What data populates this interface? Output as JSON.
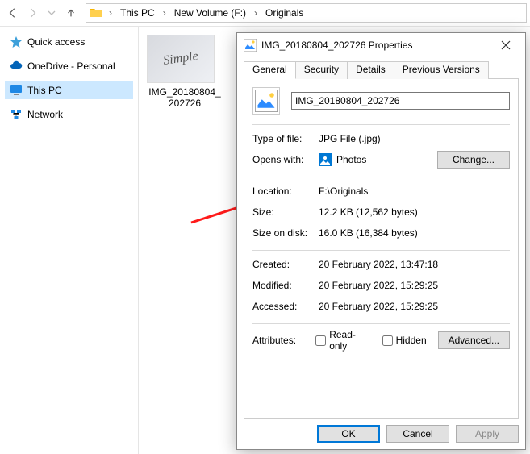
{
  "nav": {
    "breadcrumbs": [
      "This PC",
      "New Volume (F:)",
      "Originals"
    ]
  },
  "tree": {
    "quick_access": "Quick access",
    "onedrive": "OneDrive - Personal",
    "this_pc": "This PC",
    "network": "Network"
  },
  "file": {
    "thumb_name": "IMG_20180804_202726"
  },
  "dialog": {
    "title": "IMG_20180804_202726 Properties",
    "tabs": {
      "general": "General",
      "security": "Security",
      "details": "Details",
      "prev": "Previous Versions"
    },
    "filename": "IMG_20180804_202726",
    "labels": {
      "type": "Type of file:",
      "opens": "Opens with:",
      "location": "Location:",
      "size": "Size:",
      "disk": "Size on disk:",
      "created": "Created:",
      "modified": "Modified:",
      "accessed": "Accessed:",
      "attributes": "Attributes:"
    },
    "values": {
      "type": "JPG File (.jpg)",
      "opens": "Photos",
      "location": "F:\\Originals",
      "size": "12.2 KB (12,562 bytes)",
      "disk": "16.0 KB (16,384 bytes)",
      "created": "20 February 2022, 13:47:18",
      "modified": "20 February 2022, 15:29:25",
      "accessed": "20 February 2022, 15:29:25"
    },
    "attr": {
      "readonly": "Read-only",
      "hidden": "Hidden"
    },
    "buttons": {
      "change": "Change...",
      "advanced": "Advanced...",
      "ok": "OK",
      "cancel": "Cancel",
      "apply": "Apply"
    }
  }
}
